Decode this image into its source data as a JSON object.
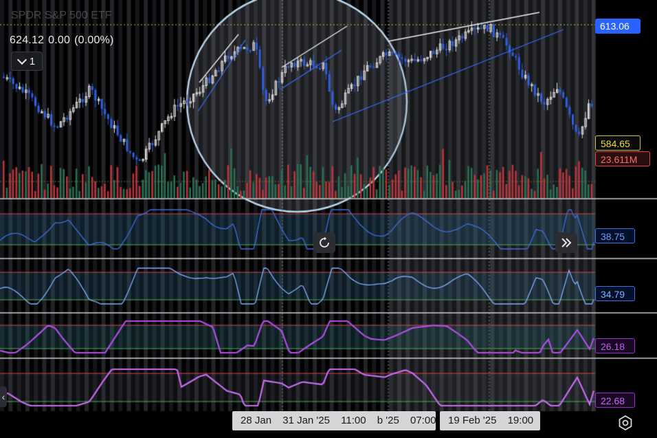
{
  "header": {
    "ticker_ghost": "SPDR S&P 500 ETF",
    "ohlc": {
      "value": "624.12",
      "change": "0.00",
      "change_pct": "(0.00%)"
    },
    "collapse_count": "1"
  },
  "price_scale": {
    "last_price": "613.06",
    "close_price": "584.65",
    "volume": "23.611M"
  },
  "indicators": [
    {
      "value": "38.75",
      "color": "#3f6fe0"
    },
    {
      "value": "34.79",
      "color": "#7fb2ff"
    },
    {
      "value": "26.18",
      "color": "#b04ee8"
    },
    {
      "value": "22.68",
      "color": "#c86cf2"
    }
  ],
  "time_axis": {
    "labels_a": [
      "28 Jan",
      "31 Jan '25",
      "11:00",
      "b '25",
      "07:00"
    ],
    "labels_b": [
      "19 Feb '25",
      "19:00"
    ]
  },
  "colors": {
    "up": "#e0e0e0",
    "down": "#2f5fe0",
    "vol_up": "#2f7d5a",
    "vol_down": "#c0393f",
    "threshold_high": "#d9494e",
    "threshold_low": "#4caf50"
  },
  "icons": {
    "reset": "reset-icon",
    "forward": "double-chevron-right-icon",
    "settings": "settings-icon",
    "collapse": "chevron-down-icon"
  }
}
